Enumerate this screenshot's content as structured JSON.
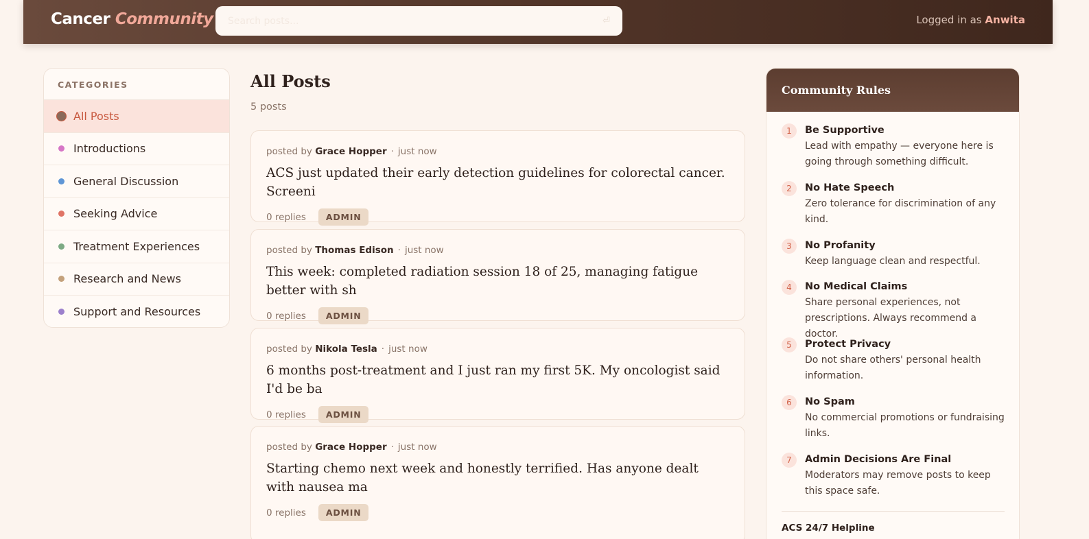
{
  "header": {
    "brand_primary": "Cancer",
    "brand_accent": "Community",
    "search_placeholder": "Search posts...",
    "search_shortcut": "⏎",
    "login_prefix": "Logged in as",
    "username": "Anwita"
  },
  "sidebar": {
    "title": "CATEGORIES",
    "items": [
      {
        "label": "All Posts",
        "color": "#8a6a5a",
        "active": true
      },
      {
        "label": "Introductions",
        "color": "#d676c6"
      },
      {
        "label": "General Discussion",
        "color": "#5f96d6"
      },
      {
        "label": "Seeking Advice",
        "color": "#e07466"
      },
      {
        "label": "Treatment Experiences",
        "color": "#7daa84"
      },
      {
        "label": "Research and News",
        "color": "#c4a17c"
      },
      {
        "label": "Support and Resources",
        "color": "#9c80cc"
      }
    ]
  },
  "main": {
    "title": "All Posts",
    "count": "5 posts",
    "posts": [
      {
        "prefix": "posted by",
        "author": "Grace Hopper",
        "time": "just now",
        "title": "ACS just updated their early detection guidelines for colorectal cancer. Screeni",
        "replies": "0 replies",
        "badge": "ADMIN"
      },
      {
        "prefix": "posted by",
        "author": "Thomas Edison",
        "time": "just now",
        "title": "This week: completed radiation session 18 of 25, managing fatigue better with sh",
        "replies": "0 replies",
        "badge": "ADMIN"
      },
      {
        "prefix": "posted by",
        "author": "Nikola Tesla",
        "time": "just now",
        "title": "6 months post-treatment and I just ran my first 5K. My oncologist said I'd be ba",
        "replies": "0 replies",
        "badge": "ADMIN"
      },
      {
        "prefix": "posted by",
        "author": "Grace Hopper",
        "time": "just now",
        "title": "Starting chemo next week and honestly terrified. Has anyone dealt with nausea ma",
        "replies": "0 replies",
        "badge": "ADMIN"
      }
    ]
  },
  "rules": {
    "title": "Community Rules",
    "items": [
      {
        "num": "1",
        "title": "Be Supportive",
        "desc": "Lead with empathy — everyone here is going through something difficult."
      },
      {
        "num": "2",
        "title": "No Hate Speech",
        "desc": "Zero tolerance for discrimination of any kind."
      },
      {
        "num": "3",
        "title": "No Profanity",
        "desc": "Keep language clean and respectful."
      },
      {
        "num": "4",
        "title": "No Medical Claims",
        "desc": "Share personal experiences, not prescriptions. Always recommend a doctor."
      },
      {
        "num": "5",
        "title": "Protect Privacy",
        "desc": "Do not share others' personal health information."
      },
      {
        "num": "6",
        "title": "No Spam",
        "desc": "No commercial promotions or fundraising links."
      },
      {
        "num": "7",
        "title": "Admin Decisions Are Final",
        "desc": "Moderators may remove posts to keep this space safe."
      }
    ],
    "helpline": "ACS 24/7 Helpline"
  }
}
